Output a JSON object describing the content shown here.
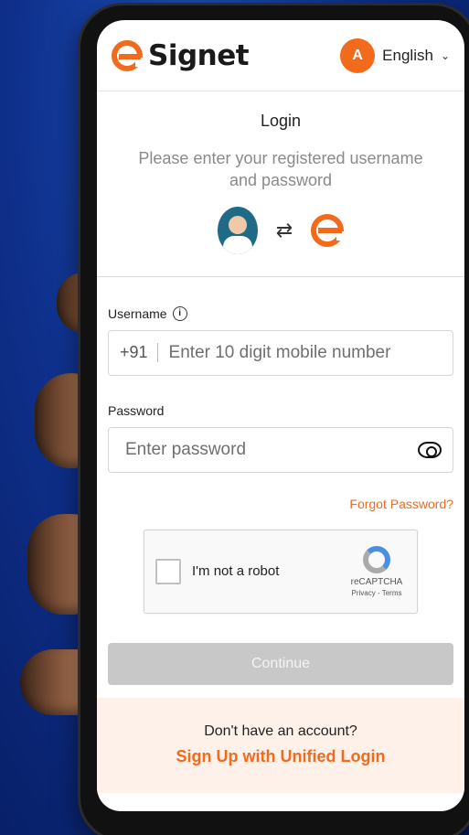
{
  "header": {
    "brand": "Signet",
    "language_label": "English",
    "language_icon_text": "A"
  },
  "login": {
    "title": "Login",
    "subtitle": "Please enter your registered username and password"
  },
  "form": {
    "username_label": "Username",
    "country_code": "+91",
    "username_placeholder": "Enter 10 digit mobile number",
    "password_label": "Password",
    "password_placeholder": "Enter password",
    "forgot_label": "Forgot Password?"
  },
  "captcha": {
    "label": "I'm not a robot",
    "brand": "reCAPTCHA",
    "links": "Privacy - Terms"
  },
  "actions": {
    "continue_label": "Continue"
  },
  "signup": {
    "question": "Don't have an account?",
    "link_label": "Sign Up with Unified Login"
  },
  "colors": {
    "accent": "#f26a1b",
    "background": "#0e2f8a"
  },
  "icons": {
    "language": "translate-icon",
    "info": "info-icon",
    "eye": "eye-icon",
    "swap": "swap-arrows-icon"
  }
}
